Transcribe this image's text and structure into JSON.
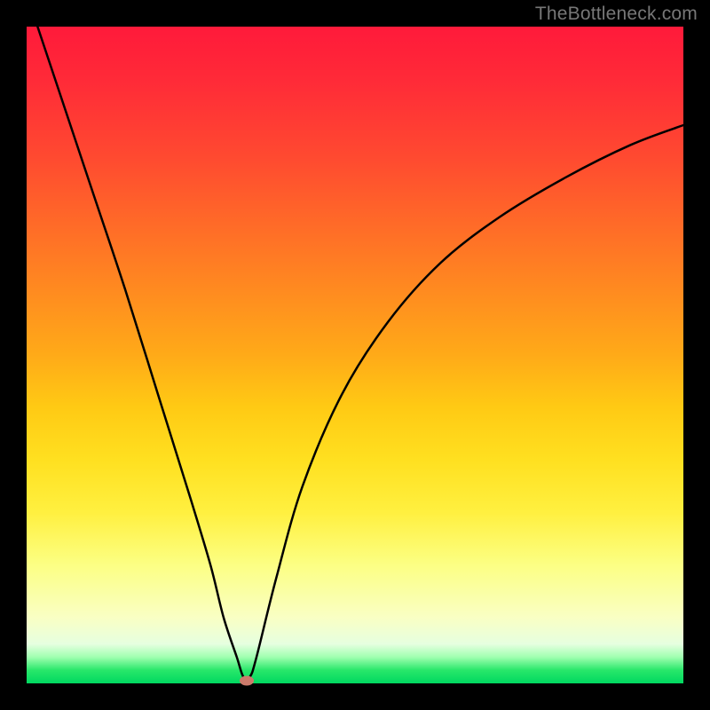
{
  "watermark": "TheBottleneck.com",
  "colors": {
    "frame": "#000000",
    "curve": "#000000",
    "marker": "#cc7a6b",
    "gradient_top": "#ff1a3a",
    "gradient_bottom": "#00d860"
  },
  "chart_data": {
    "type": "line",
    "title": "",
    "xlabel": "",
    "ylabel": "",
    "xlim": [
      0,
      1
    ],
    "ylim": [
      0,
      1
    ],
    "series": [
      {
        "name": "bottleneck-curve",
        "x": [
          0.0,
          0.05,
          0.1,
          0.15,
          0.2,
          0.25,
          0.28,
          0.3,
          0.32,
          0.33,
          0.34,
          0.35,
          0.38,
          0.42,
          0.48,
          0.55,
          0.63,
          0.72,
          0.82,
          0.92,
          1.0
        ],
        "values": [
          1.05,
          0.9,
          0.75,
          0.6,
          0.44,
          0.28,
          0.18,
          0.1,
          0.04,
          0.01,
          0.01,
          0.04,
          0.16,
          0.3,
          0.44,
          0.55,
          0.64,
          0.71,
          0.77,
          0.82,
          0.85
        ]
      }
    ],
    "annotations": [
      {
        "name": "minimum-point",
        "x": 0.335,
        "y": 0.0
      }
    ],
    "grid": false,
    "legend": false
  }
}
